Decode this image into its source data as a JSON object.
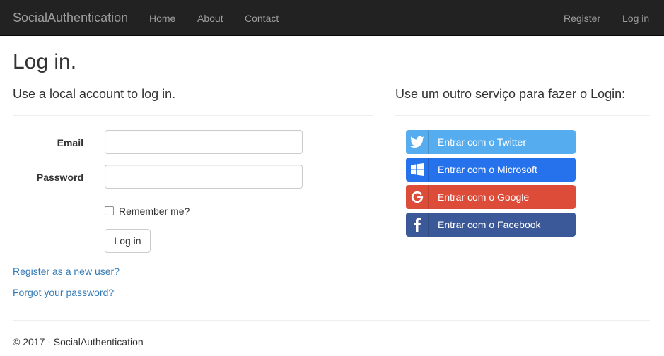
{
  "navbar": {
    "brand": "SocialAuthentication",
    "left_links": [
      "Home",
      "About",
      "Contact"
    ],
    "right_links": [
      "Register",
      "Log in"
    ]
  },
  "page": {
    "title": "Log in."
  },
  "local_login": {
    "heading": "Use a local account to log in.",
    "email_label": "Email",
    "email_value": "",
    "password_label": "Password",
    "password_value": "",
    "remember_label": "Remember me?",
    "remember_checked": false,
    "submit_label": "Log in",
    "register_link": "Register as a new user?",
    "forgot_link": "Forgot your password?"
  },
  "external_login": {
    "heading": "Use um outro serviço para fazer o Login:",
    "providers": [
      {
        "label": "Entrar com o Twitter",
        "icon": "twitter-icon",
        "color": "#55acee"
      },
      {
        "label": "Entrar com o Microsoft",
        "icon": "windows-icon",
        "color": "#2672ec"
      },
      {
        "label": "Entrar com o Google",
        "icon": "google-icon",
        "color": "#dd4b39"
      },
      {
        "label": "Entrar com o Facebook",
        "icon": "facebook-icon",
        "color": "#3b5998"
      }
    ]
  },
  "footer": {
    "text": "© 2017 - SocialAuthentication"
  },
  "colors": {
    "navbar_bg": "#222222",
    "navbar_text": "#9d9d9d",
    "link": "#337ab7"
  }
}
